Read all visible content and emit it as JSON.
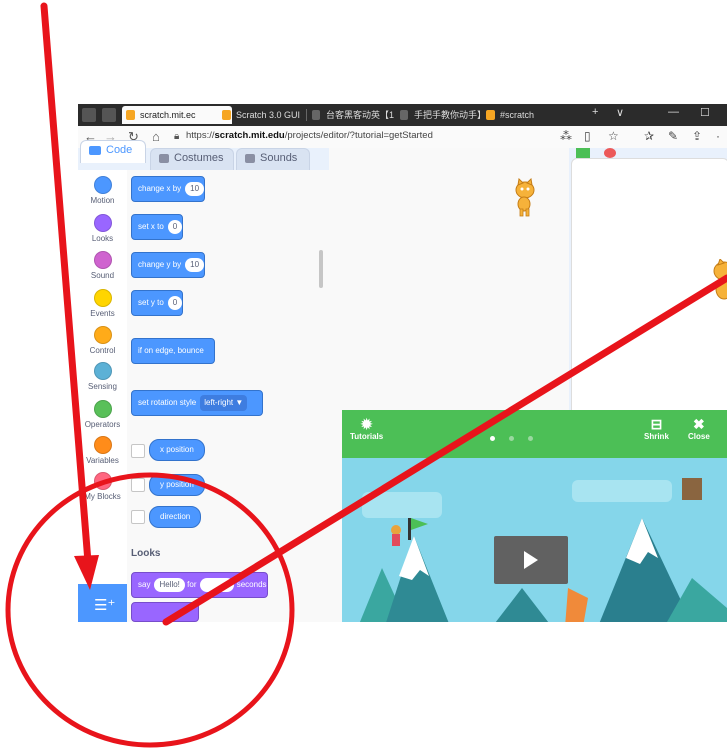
{
  "browser": {
    "tabs": [
      {
        "label": "scratch.mit.ec",
        "active": true
      },
      {
        "label": "Scratch 3.0 GUI",
        "active": false
      },
      {
        "label": "台客黑客动英【1",
        "active": false
      },
      {
        "label": "手把手教你动手】",
        "active": false
      },
      {
        "label": "#scratch",
        "active": false
      }
    ],
    "tab_close": "×",
    "new_tab": "+",
    "tab_menu": "∨",
    "url_prefix": "https://",
    "url_domain": "scratch.mit.edu",
    "url_path": "/projects/editor/?tutorial=getStarted"
  },
  "editor": {
    "tabs": {
      "code": "Code",
      "costumes": "Costumes",
      "sounds": "Sounds"
    },
    "categories": [
      {
        "label": "Motion",
        "color": "#4c97ff"
      },
      {
        "label": "Looks",
        "color": "#9966ff"
      },
      {
        "label": "Sound",
        "color": "#cf63cf"
      },
      {
        "label": "Events",
        "color": "#ffd500"
      },
      {
        "label": "Control",
        "color": "#ffab19"
      },
      {
        "label": "Sensing",
        "color": "#5cb1d6"
      },
      {
        "label": "Operators",
        "color": "#59c059"
      },
      {
        "label": "Variables",
        "color": "#ff8c1a"
      },
      {
        "label": "My Blocks",
        "color": "#ff6680"
      }
    ],
    "blocks": {
      "change_x": {
        "text": "change x by",
        "value": "10"
      },
      "set_x": {
        "text": "set x to",
        "value": "0"
      },
      "change_y": {
        "text": "change y by",
        "value": "10"
      },
      "set_y": {
        "text": "set y to",
        "value": "0"
      },
      "bounce": {
        "text": "if on edge, bounce"
      },
      "rotation": {
        "text": "set rotation style",
        "value": "left-right ▼"
      },
      "x_position": "x position",
      "y_position": "y position",
      "direction": "direction",
      "looks_heading": "Looks",
      "say": {
        "text": "say",
        "value": "Hello!",
        "for": "for",
        "seconds": "seconds"
      }
    }
  },
  "tutorial": {
    "tutorials_label": "Tutorials",
    "shrink_label": "Shrink",
    "close_label": "Close",
    "step_count": 3,
    "current_step": 1
  },
  "colors": {
    "annotation_red": "#e8141b",
    "scratch_blue": "#4c97ff",
    "tutorial_green": "#4cbf56"
  }
}
